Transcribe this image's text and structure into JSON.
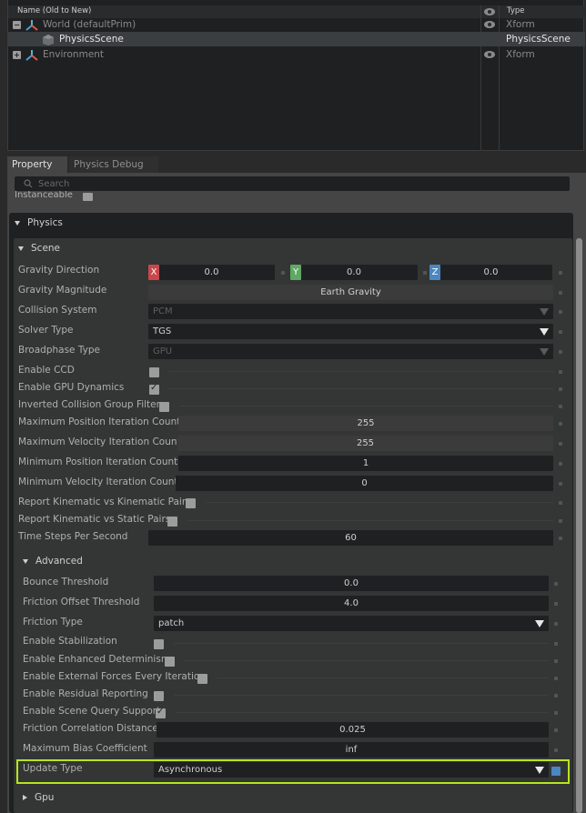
{
  "stage": {
    "columns": {
      "name": "Name (Old to New)",
      "type": "Type"
    },
    "rows": [
      {
        "name": "World (defaultPrim)",
        "type": "Xform",
        "toggle": "−",
        "icon": "xform-axis-icon",
        "visible": true
      },
      {
        "name": "PhysicsScene",
        "type": "PhysicsScene",
        "icon": "physics-scene-cube-icon",
        "selected": true
      },
      {
        "name": "Environment",
        "type": "Xform",
        "toggle": "+",
        "icon": "xform-axis-icon",
        "visible": true
      }
    ]
  },
  "tabs": [
    {
      "label": "Property",
      "active": true
    },
    {
      "label": "Physics Debug",
      "active": false
    }
  ],
  "search": {
    "placeholder": "Search"
  },
  "instanceable": {
    "label": "Instanceable",
    "checked": false
  },
  "physics": {
    "title": "Physics",
    "scene": {
      "title": "Scene",
      "gravity_direction": {
        "label": "Gravity Direction",
        "x": "0.0",
        "y": "0.0",
        "z": "0.0",
        "x_label": "X",
        "y_label": "Y",
        "z_label": "Z"
      },
      "gravity_magnitude": {
        "label": "Gravity Magnitude",
        "value": "Earth Gravity"
      },
      "collision_system": {
        "label": "Collision System",
        "value": "PCM"
      },
      "solver_type": {
        "label": "Solver Type",
        "value": "TGS"
      },
      "broadphase_type": {
        "label": "Broadphase Type",
        "value": "GPU"
      },
      "enable_ccd": {
        "label": "Enable CCD",
        "checked": false
      },
      "enable_gpu_dynamics": {
        "label": "Enable GPU Dynamics",
        "checked": true
      },
      "inverted_collision_group_filter": {
        "label": "Inverted Collision Group Filter",
        "checked": false
      },
      "max_position_iteration_count": {
        "label": "Maximum Position Iteration Count",
        "value": "255"
      },
      "max_velocity_iteration_count": {
        "label": "Maximum Velocity Iteration Count",
        "value": "255"
      },
      "min_position_iteration_count": {
        "label": "Minimum Position Iteration Count",
        "value": "1"
      },
      "min_velocity_iteration_count": {
        "label": "Minimum Velocity Iteration Count",
        "value": "0"
      },
      "report_kinematic_kinematic": {
        "label": "Report Kinematic vs Kinematic Pairs",
        "checked": false
      },
      "report_kinematic_static": {
        "label": "Report Kinematic vs Static Pairs",
        "checked": false
      },
      "time_steps_per_second": {
        "label": "Time Steps Per Second",
        "value": "60"
      }
    },
    "advanced": {
      "title": "Advanced",
      "bounce_threshold": {
        "label": "Bounce Threshold",
        "value": "0.0"
      },
      "friction_offset_threshold": {
        "label": "Friction Offset Threshold",
        "value": "4.0"
      },
      "friction_type": {
        "label": "Friction Type",
        "value": "patch"
      },
      "enable_stabilization": {
        "label": "Enable Stabilization",
        "checked": false
      },
      "enable_enhanced_determinism": {
        "label": "Enable Enhanced Determinism",
        "checked": false
      },
      "enable_external_forces": {
        "label": "Enable External Forces Every Iteration",
        "checked": false
      },
      "enable_residual_reporting": {
        "label": "Enable Residual Reporting",
        "checked": false
      },
      "enable_scene_query_support": {
        "label": "Enable Scene Query Support",
        "checked": true
      },
      "friction_correlation_distance": {
        "label": "Friction Correlation Distance",
        "value": "0.025"
      },
      "max_bias_coefficient": {
        "label": "Maximum Bias Coefficient",
        "value": "inf"
      },
      "update_type": {
        "label": "Update Type",
        "value": "Asynchronous"
      }
    },
    "gpu": {
      "title": "Gpu"
    }
  },
  "colors": {
    "highlight": "#b5e61d",
    "axis_x": "#c8474b",
    "axis_y": "#5fa866",
    "axis_z": "#4a87c0",
    "modified_indicator": "#4a87c0"
  }
}
